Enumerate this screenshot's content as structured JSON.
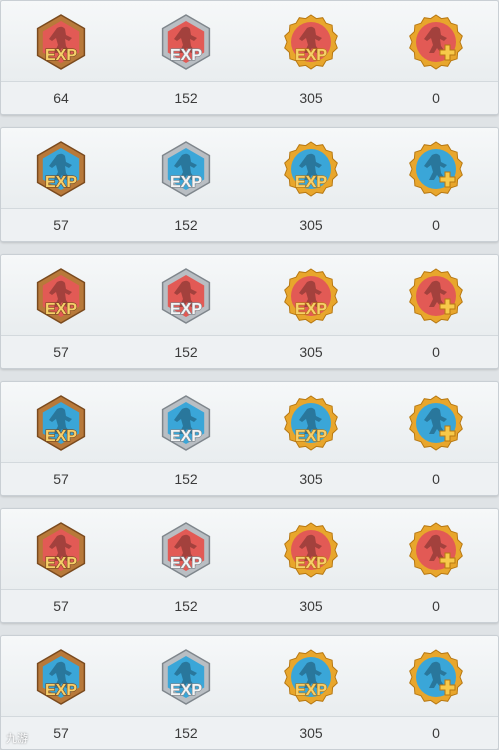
{
  "colors": {
    "red": "#e25a55",
    "blue": "#3aa6d8",
    "bronze": "#b8793a",
    "silver": "#b9bec3",
    "gold": "#e8a62c"
  },
  "badges": [
    {
      "tier": "bronze",
      "label": "EXP"
    },
    {
      "tier": "silver",
      "label": "EXP"
    },
    {
      "tier": "gold",
      "label": "EXP"
    },
    {
      "tier": "gold-plus",
      "label": ""
    }
  ],
  "rows": [
    {
      "theme": "red",
      "icon": "player-icon",
      "values": [
        "64",
        "152",
        "305",
        "0"
      ]
    },
    {
      "theme": "blue",
      "icon": "player-icon",
      "values": [
        "57",
        "152",
        "305",
        "0"
      ]
    },
    {
      "theme": "red",
      "icon": "player-icon",
      "values": [
        "57",
        "152",
        "305",
        "0"
      ]
    },
    {
      "theme": "blue",
      "icon": "player-icon",
      "values": [
        "57",
        "152",
        "305",
        "0"
      ]
    },
    {
      "theme": "red",
      "icon": "player-icon",
      "values": [
        "57",
        "152",
        "305",
        "0"
      ]
    },
    {
      "theme": "blue",
      "icon": "player-icon",
      "values": [
        "57",
        "152",
        "305",
        "0"
      ]
    }
  ],
  "watermark": "九游"
}
